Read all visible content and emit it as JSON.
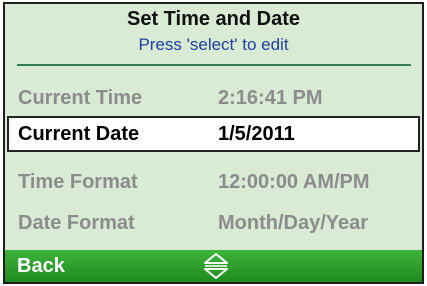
{
  "header": {
    "title": "Set Time and Date",
    "subtitle": "Press 'select' to edit"
  },
  "settings": [
    {
      "label": "Current Time",
      "value": "2:16:41 PM",
      "selected": false
    },
    {
      "label": "Current Date",
      "value": "1/5/2011",
      "selected": true
    },
    {
      "label": "Time Format",
      "value": "12:00:00 AM/PM",
      "selected": false
    },
    {
      "label": "Date Format",
      "value": "Month/Day/Year",
      "selected": false
    }
  ],
  "footer": {
    "back_label": "Back",
    "nav_icon": "up-down-arrows-icon"
  },
  "colors": {
    "background": "#d9ead5",
    "accent_green": "#2e9a2c",
    "subtitle_blue": "#1e3fa0",
    "inactive_text": "#8c8c8c"
  }
}
